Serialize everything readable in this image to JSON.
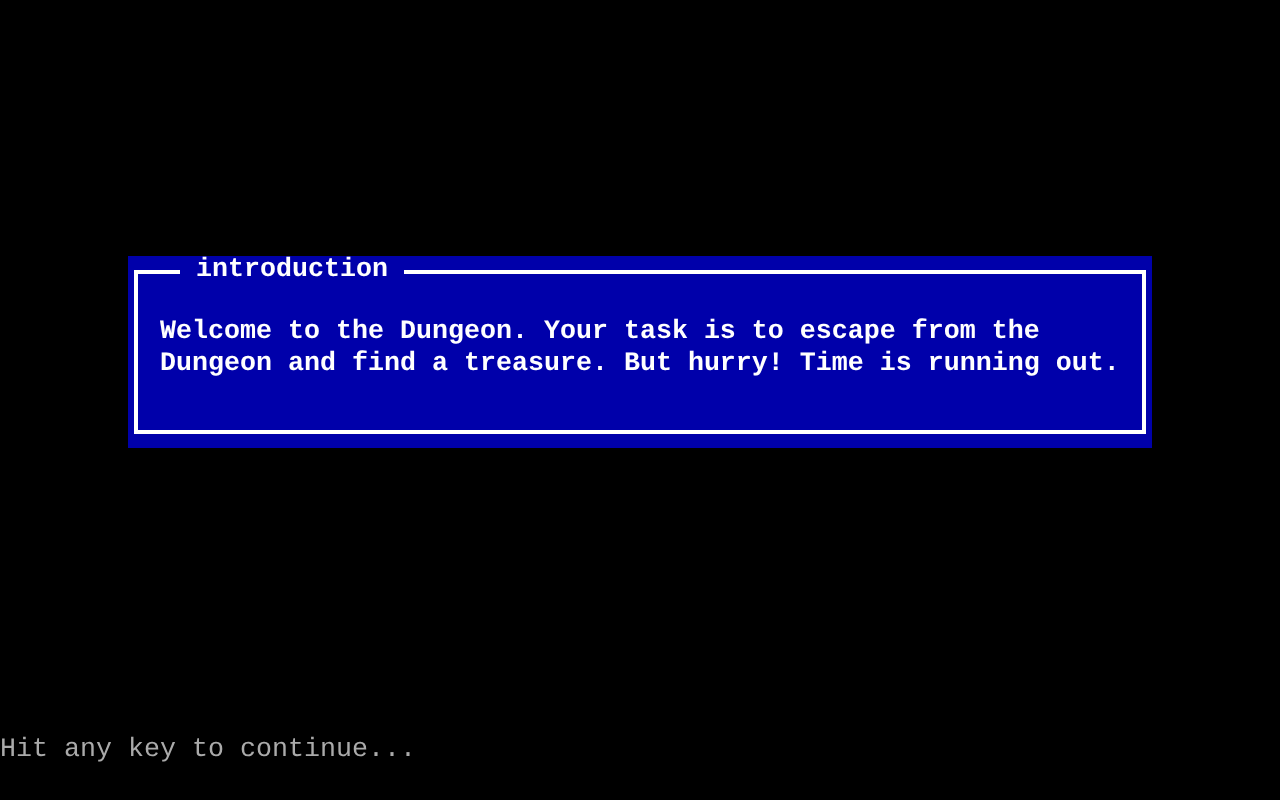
{
  "dialog": {
    "title": "introduction",
    "message": "Welcome to the Dungeon. Your task is to escape from the Dungeon and find a treasure. But hurry! Time is running out."
  },
  "prompt": "Hit any key to continue..."
}
